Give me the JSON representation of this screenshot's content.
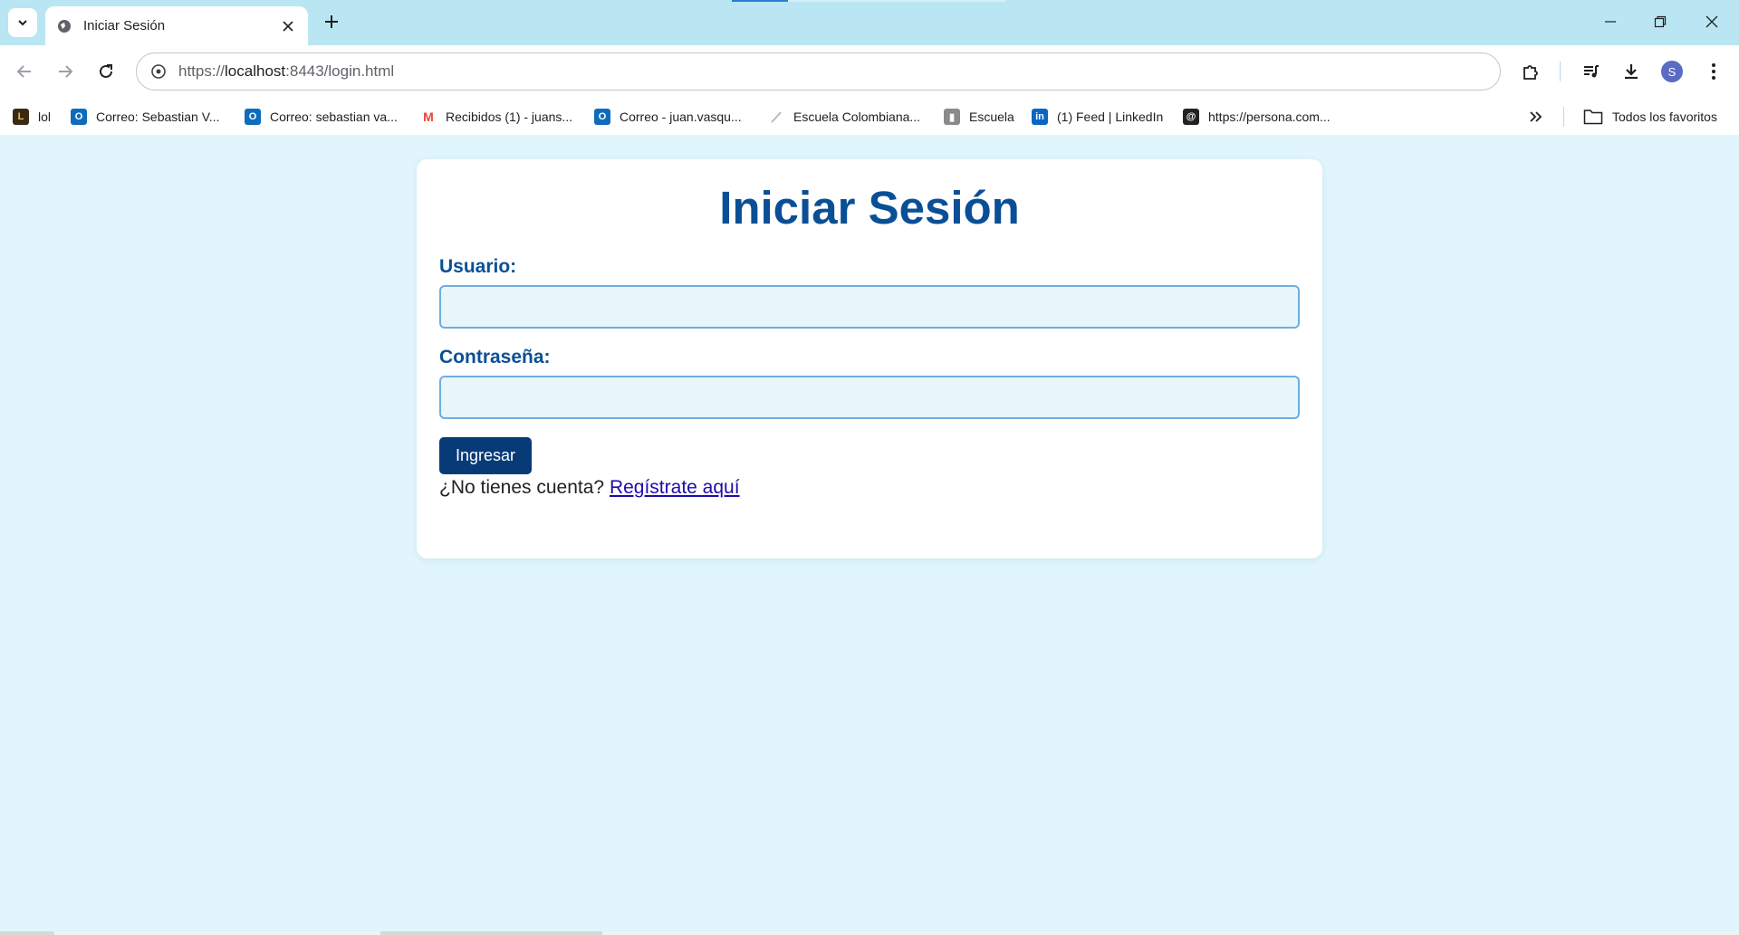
{
  "browser": {
    "tab": {
      "title": "Iniciar Sesión"
    },
    "address": {
      "scheme": "https://",
      "host": "localhost",
      "rest": ":8443/login.html"
    },
    "profile_initial": "S",
    "bookmarks": [
      {
        "label": "lol",
        "icon": "game-icon",
        "color": "#3a2a10"
      },
      {
        "label": "Correo: Sebastian V...",
        "icon": "outlook-icon",
        "color": "#0f6cbd"
      },
      {
        "label": "Correo: sebastian va...",
        "icon": "outlook-icon",
        "color": "#0f6cbd"
      },
      {
        "label": "Recibidos (1) - juans...",
        "icon": "gmail-icon",
        "color": "#ea4335"
      },
      {
        "label": "Correo - juan.vasqu...",
        "icon": "outlook-icon",
        "color": "#0f6cbd"
      },
      {
        "label": "Escuela Colombiana...",
        "icon": "quill-icon",
        "color": "#bbbbbb"
      },
      {
        "label": "Escuela",
        "icon": "building-icon",
        "color": "#777777"
      },
      {
        "label": "(1) Feed | LinkedIn",
        "icon": "linkedin-icon",
        "color": "#0a66c2"
      },
      {
        "label": "https://persona.com...",
        "icon": "globe-icon",
        "color": "#222222"
      }
    ],
    "all_bookmarks_label": "Todos los favoritos"
  },
  "page": {
    "title": "Iniciar Sesión",
    "username_label": "Usuario:",
    "username_value": "",
    "password_label": "Contraseña:",
    "password_value": "",
    "submit_label": "Ingresar",
    "register_prompt": "¿No tienes cuenta?",
    "register_link": "Regístrate aquí"
  },
  "colors": {
    "page_background": "#e0f5fc",
    "heading": "#0a4f96",
    "button": "#073b78",
    "input_border": "#6eaedf"
  }
}
